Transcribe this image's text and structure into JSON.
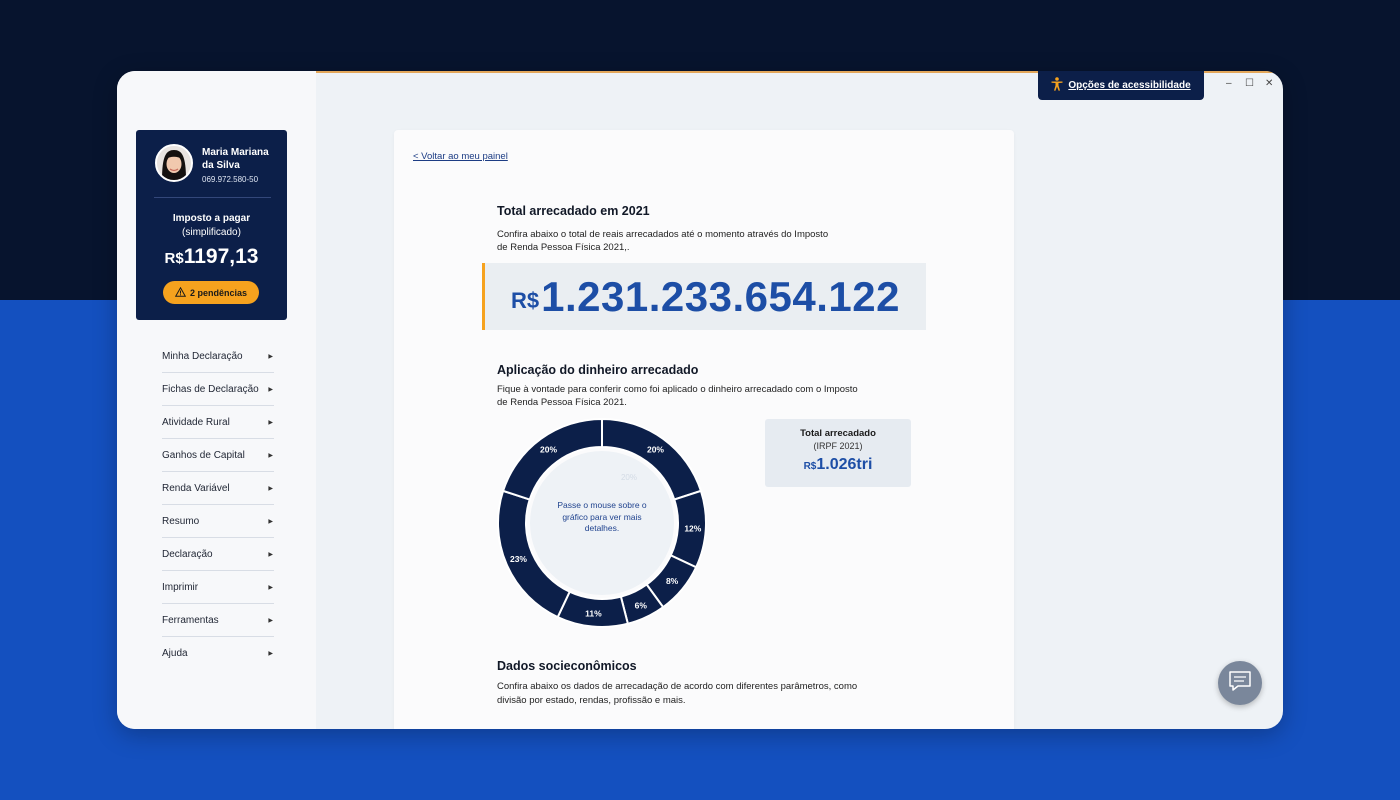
{
  "window": {
    "accessibility_label": "Opções de acessibilidade",
    "controls": {
      "minimize": "–",
      "maximize": "☐",
      "close": "✕"
    }
  },
  "user": {
    "name": "Maria Mariana da Silva",
    "cpf": "069.972.580-50"
  },
  "tax": {
    "title": "Imposto a pagar",
    "subtitle": "(simplificado)",
    "currency": "R$",
    "value": "1197,13",
    "pending_label": "2 pendências"
  },
  "menu": [
    {
      "label": "Minha Declaração"
    },
    {
      "label": "Fichas de Declaração"
    },
    {
      "label": "Atividade Rural"
    },
    {
      "label": "Ganhos de Capital"
    },
    {
      "label": "Renda Variável"
    },
    {
      "label": "Resumo"
    },
    {
      "label": "Declaração"
    },
    {
      "label": "Imprimir"
    },
    {
      "label": "Ferramentas"
    },
    {
      "label": "Ajuda"
    }
  ],
  "content": {
    "back_link": "< Voltar ao meu painel",
    "total": {
      "title": "Total arrecadado em 2021",
      "description_line1": "Confira abaixo o total de reais arrecadados até o momento através do Imposto",
      "description_line2": "de Renda Pessoa Física 2021,.",
      "currency": "R$",
      "value": "1.231.233.654.122"
    },
    "application": {
      "title": "Aplicação do dinheiro arrecadado",
      "description_line1": "Fique à vontade para conferir como foi aplicado o dinheiro arrecadado com o Imposto",
      "description_line2": "de Renda Pessoa Física 2021.",
      "hover_hint": "Passe o mouse sobre o gráfico para ver mais detalhes.",
      "card": {
        "title": "Total arrecadado",
        "subtitle": "(IRPF 2021)",
        "currency": "R$",
        "value": "1.026tri"
      }
    },
    "socio": {
      "title": "Dados socieconômicos",
      "description_line1": "Confira abaixo os dados de arrecadação de acordo com diferentes parâmetros, como",
      "description_line2": "divisão por estado, rendas, profissão e mais."
    }
  },
  "chart_data": {
    "type": "pie",
    "donut": true,
    "values": [
      20,
      12,
      8,
      6,
      11,
      23,
      20
    ],
    "labels": [
      "20%",
      "12%",
      "8%",
      "6%",
      "11%",
      "23%",
      "20%"
    ],
    "color": "#0c1f49",
    "background_label": "20%"
  }
}
